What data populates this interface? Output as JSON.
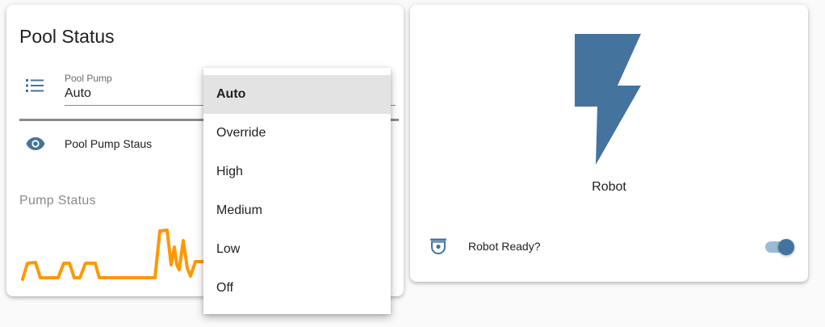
{
  "pool_card": {
    "title": "Pool Status",
    "select": {
      "label": "Pool Pump",
      "value": "Auto",
      "icon": "format-list-bulleted-icon"
    },
    "sensor": {
      "name": "Pool Pump Staus",
      "icon": "eye-icon"
    },
    "graph": {
      "title": "Pump Status",
      "color": "#ff9800"
    }
  },
  "dropdown": {
    "options": [
      "Auto",
      "Override",
      "High",
      "Medium",
      "Low",
      "Off"
    ],
    "selected": "Auto"
  },
  "robot_card": {
    "name": "Robot",
    "icon": "flash-icon",
    "icon_color": "#44739e",
    "toggle": {
      "label": "Robot Ready?",
      "icon": "cctv-icon",
      "state": "on"
    }
  },
  "colors": {
    "accent": "#44739e",
    "graph": "#ff9800"
  }
}
